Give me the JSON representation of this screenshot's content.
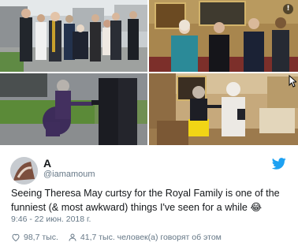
{
  "photos": [
    {
      "name": "royal-family-outdoor-photo"
    },
    {
      "name": "handshake-gold-room-photo"
    },
    {
      "name": "curtsy-outdoor-photo"
    },
    {
      "name": "curtsy-queen-palace-photo"
    }
  ],
  "tweet": {
    "user": {
      "name": "A",
      "handle": "@iamamoum"
    },
    "text": "Seeing Theresa May curtsy for the Royal Family is one of the funniest (& most awkward) things I've seen for a while",
    "emoji": "😂",
    "timestamp": "9:46 - 22 июн. 2018 г.",
    "likes": "98,7 тыс.",
    "talk": "41,7 тыс. человек(а) говорят об этом"
  },
  "icons": {
    "info": "info-icon",
    "bird": "twitter-bird-icon",
    "heart": "heart-icon",
    "talk": "person-icon"
  },
  "colors": {
    "brand": "#1da1f2",
    "meta": "#657786",
    "text": "#14171a"
  }
}
